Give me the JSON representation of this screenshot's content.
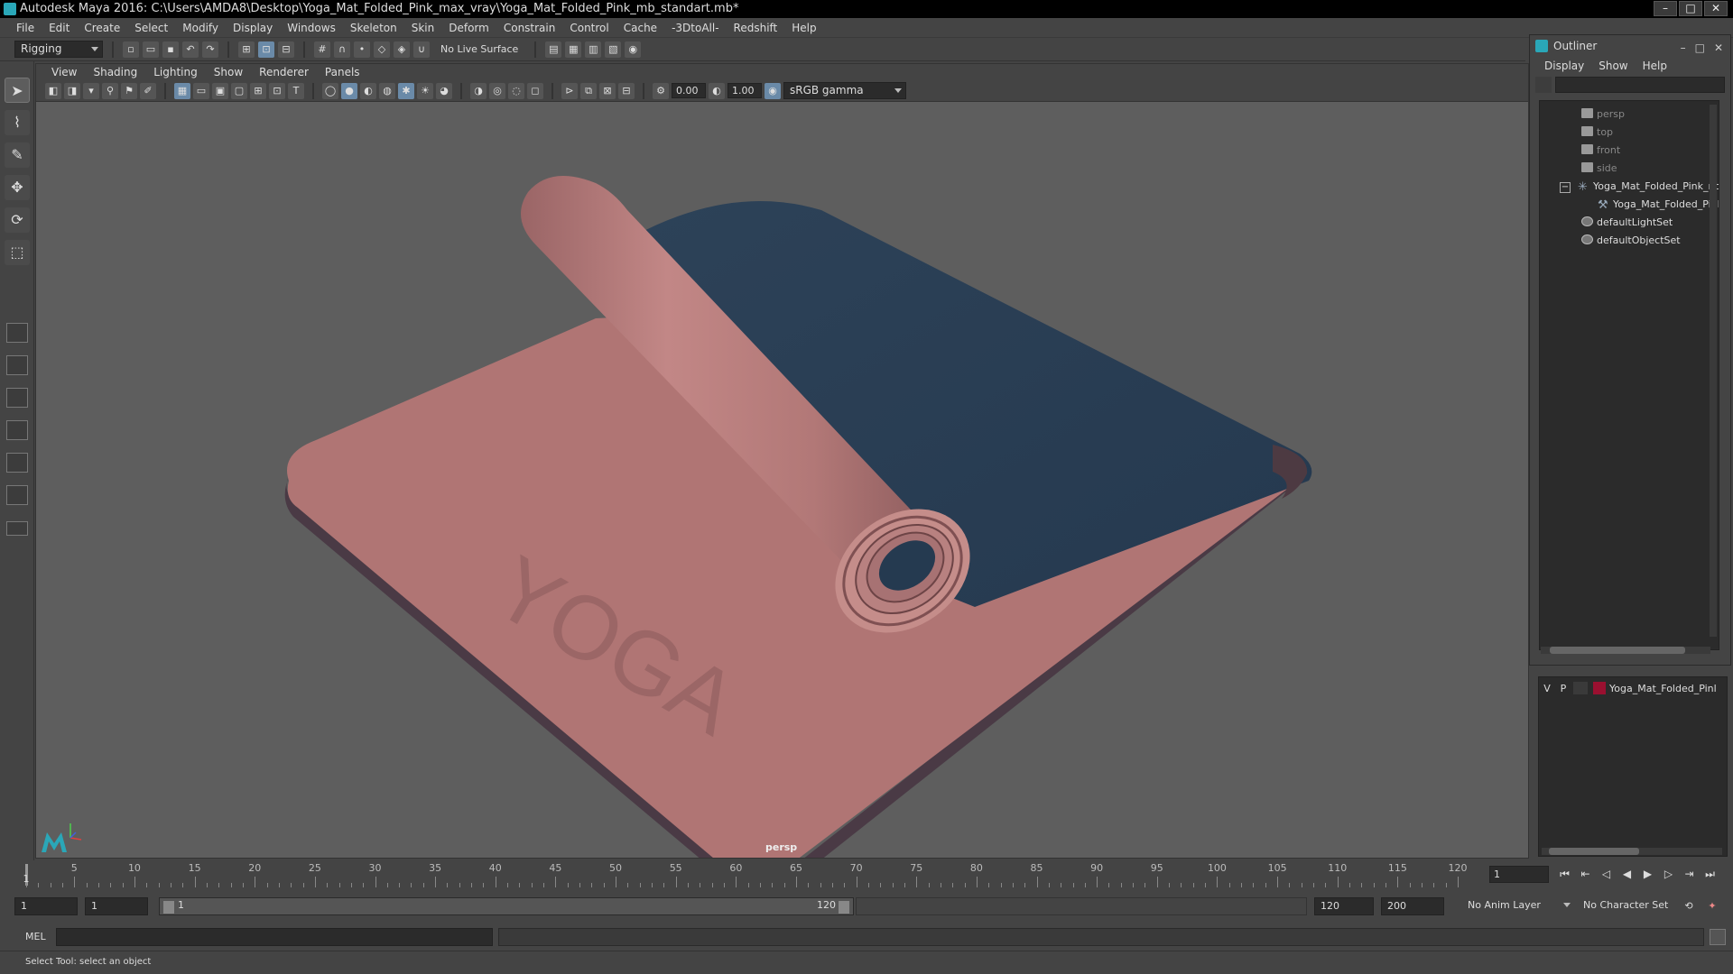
{
  "window": {
    "title": "Autodesk Maya 2016: C:\\Users\\AMDA8\\Desktop\\Yoga_Mat_Folded_Pink_max_vray\\Yoga_Mat_Folded_Pink_mb_standart.mb*"
  },
  "menubar": [
    "File",
    "Edit",
    "Create",
    "Select",
    "Modify",
    "Display",
    "Windows",
    "Skeleton",
    "Skin",
    "Deform",
    "Constrain",
    "Control",
    "Cache",
    "-3DtoAll-",
    "Redshift",
    "Help"
  ],
  "statusline": {
    "mode": "Rigging",
    "live_surface": "No Live Surface"
  },
  "viewport": {
    "menus": [
      "View",
      "Shading",
      "Lighting",
      "Show",
      "Renderer",
      "Panels"
    ],
    "exposure": "0.00",
    "gamma": "1.00",
    "colorspace": "sRGB gamma",
    "camera_label": "persp",
    "mat_text": "YOGA"
  },
  "outliner": {
    "title": "Outliner",
    "menus": [
      "Display",
      "Show",
      "Help"
    ],
    "items": [
      {
        "label": "persp",
        "type": "camera"
      },
      {
        "label": "top",
        "type": "camera"
      },
      {
        "label": "front",
        "type": "camera"
      },
      {
        "label": "side",
        "type": "camera"
      },
      {
        "label": "Yoga_Mat_Folded_Pink_nc",
        "type": "group"
      },
      {
        "label": "Yoga_Mat_Folded_Pinl",
        "type": "mesh"
      },
      {
        "label": "defaultLightSet",
        "type": "set"
      },
      {
        "label": "defaultObjectSet",
        "type": "set"
      }
    ]
  },
  "layers": {
    "v": "V",
    "p": "P",
    "name": "Yoga_Mat_Folded_Pinl",
    "color": "#9a1030"
  },
  "timeslider": {
    "ticks": [
      "5",
      "10",
      "15",
      "20",
      "25",
      "30",
      "35",
      "40",
      "45",
      "50",
      "55",
      "60",
      "65",
      "70",
      "75",
      "80",
      "85",
      "90",
      "95",
      "100",
      "105",
      "110",
      "115",
      "120"
    ],
    "current_tick": "1",
    "current_frame": "1"
  },
  "range": {
    "start": "1",
    "playback_start": "1",
    "slider_start": "1",
    "slider_end": "120",
    "playback_end": "120",
    "end": "200",
    "anim_layer": "No Anim Layer",
    "character_set": "No Character Set"
  },
  "cmdline": {
    "label": "MEL"
  },
  "helpline": {
    "text": "Select Tool: select an object"
  }
}
